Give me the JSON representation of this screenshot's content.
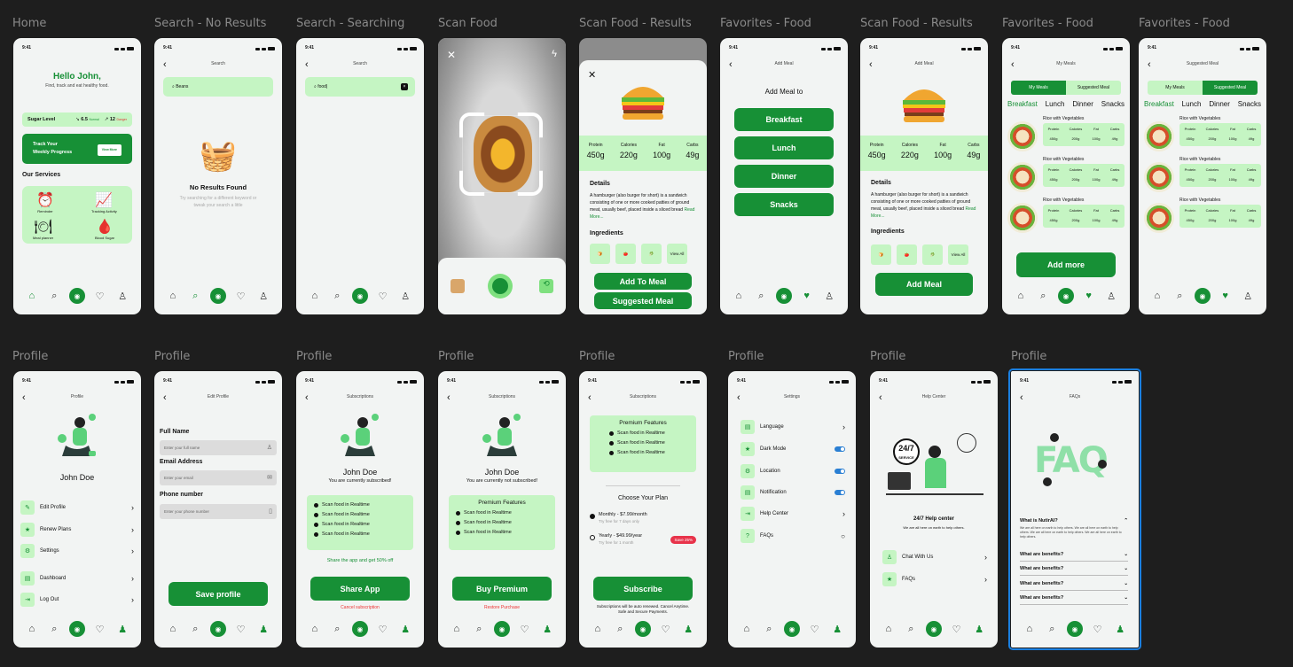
{
  "status": {
    "time": "9:41"
  },
  "labels": {
    "home": "Home",
    "search_no": "Search - No Results",
    "searching": "Search - Searching",
    "scan": "Scan Food",
    "scan_results": "Scan Food - Results",
    "fav": "Favorites - Food",
    "profile": "Profile"
  },
  "home": {
    "greeting": "Hello John,",
    "sub": "Find, track and eat healthy food.",
    "sugar_label": "Sugar Level",
    "sugar_normal": "6.5",
    "sugar_normal_tag": "Normal",
    "sugar_danger": "12",
    "sugar_danger_tag": "Danger",
    "track1": "Track Your",
    "track2": "Weekly Progress",
    "view_more": "View More",
    "services": "Our Services",
    "svc": [
      "Reminder",
      "Tracking Activity",
      "Meal planner",
      "Blood Sugar"
    ]
  },
  "search": {
    "title": "Search",
    "query_none": "Beans",
    "query": "food|",
    "no_results": "No Results Found",
    "hint": "Try searching for a different keyword or tweak your search a little"
  },
  "scan_results": {
    "nutr": [
      {
        "k": "Protein",
        "v": "450g"
      },
      {
        "k": "Calories",
        "v": "220g"
      },
      {
        "k": "Fat",
        "v": "100g"
      },
      {
        "k": "Carbs",
        "v": "49g"
      }
    ],
    "details": "Details",
    "desc": "A hamburger (also burger for short) is a sandwich consisting of one or more cooked patties of ground meat, usually beef, placed inside a sliced bread",
    "read_more": "Read More...",
    "ingredients": "Ingredients",
    "view_all": "View All",
    "add_to_meal": "Add To Meal",
    "suggested": "Suggested Meal",
    "add_meal": "Add Meal"
  },
  "add_meal": {
    "title": "Add Meal",
    "heading": "Add Meal to",
    "options": [
      "Breakfast",
      "Lunch",
      "Dinner",
      "Snacks"
    ]
  },
  "my_meals": {
    "title": "My Meals",
    "title2": "Suggested Meal",
    "tab1": "My Meals",
    "tab2": "Suggested Meal",
    "meals": [
      "Breakfast",
      "Lunch",
      "Dinner",
      "Snacks"
    ],
    "item": "Rice with Vegetables",
    "stats": [
      {
        "k": "Protein",
        "v": "450g"
      },
      {
        "k": "Calories",
        "v": "200g"
      },
      {
        "k": "Fat",
        "v": "100g"
      },
      {
        "k": "Carbs",
        "v": "49g"
      }
    ],
    "add_more": "Add more"
  },
  "profile": {
    "title": "Profile",
    "name": "John Doe",
    "menu": [
      "Edit Profile",
      "Renew Plans",
      "Settings",
      "Dashboard",
      "Log Out"
    ]
  },
  "edit_profile": {
    "title": "Edit Profile",
    "full_name": "Full Name",
    "full_name_ph": "Enter your full name",
    "email": "Email Address",
    "email_ph": "Enter your email",
    "phone": "Phone number",
    "phone_ph": "Enter your phone number",
    "save": "Save profile"
  },
  "subs": {
    "title": "Subscriptions",
    "subscribed": "You are currently subscribed!",
    "not_subscribed": "You are currently not subscribed!",
    "feature": "Scan food in Realtime",
    "premium": "Premium Features",
    "share_hint": "Share the app and get 50% off",
    "share": "Share App",
    "cancel": "Cancel subscription",
    "buy": "Buy Premium",
    "restore": "Restore Purchase",
    "choose": "Choose Your Plan",
    "monthly": "Monthly - $7.99/month",
    "monthly_trial": "Try free for 7 days only",
    "yearly": "Yearly - $49.99/year",
    "yearly_trial": "Try free for 1 month",
    "save_badge": "Save 25%",
    "subscribe": "Subscribe",
    "fine": "Subscriptions will be auto renewed. Cancel Anytime. Safe and Secure Payments."
  },
  "settings": {
    "title": "Settings",
    "items": [
      "Language",
      "Dark Mode",
      "Location",
      "Notification",
      "Help Center",
      "FAQs"
    ]
  },
  "help": {
    "title": "Help Center",
    "badge": "24/7",
    "badge_sub": "SERVICE",
    "heading": "24/7 Help center",
    "sub": "We are all here on earth to help others.",
    "items": [
      "Chat With Us",
      "FAQs"
    ]
  },
  "faqs": {
    "title": "FAQs",
    "art": "FAQ",
    "q1": "What is NutirAI?",
    "a1": "We are all here on earth to help others. We are all here on earth to help others. We are all here on earth to help others. We are all here on earth to help others.",
    "q": "What are benefits?"
  },
  "colors": {
    "primary": "#179036",
    "light": "#c5f5c3",
    "bg": "#1e1e1e"
  }
}
